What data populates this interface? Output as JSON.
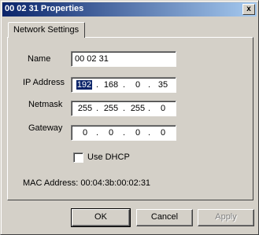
{
  "window": {
    "title": "00 02 31 Properties",
    "close_label": "x"
  },
  "tabs": [
    {
      "label": "Network Settings"
    }
  ],
  "form": {
    "name": {
      "label": "Name",
      "value": "00 02 31"
    },
    "ip": {
      "label": "IP Address",
      "octets": [
        "192",
        "168",
        "0",
        "35"
      ]
    },
    "netmask": {
      "label": "Netmask",
      "octets": [
        "255",
        "255",
        "255",
        "0"
      ]
    },
    "gateway": {
      "label": "Gateway",
      "octets": [
        "0",
        "0",
        "0",
        "0"
      ]
    },
    "dhcp": {
      "label": "Use DHCP",
      "checked": false
    },
    "mac": {
      "text": "MAC Address: 00:04:3b:00:02:31"
    }
  },
  "buttons": {
    "ok": "OK",
    "cancel": "Cancel",
    "apply": "Apply"
  },
  "colors": {
    "title_start": "#0a246a",
    "title_end": "#a6caf0",
    "face": "#d4d0c8"
  },
  "dot": "."
}
